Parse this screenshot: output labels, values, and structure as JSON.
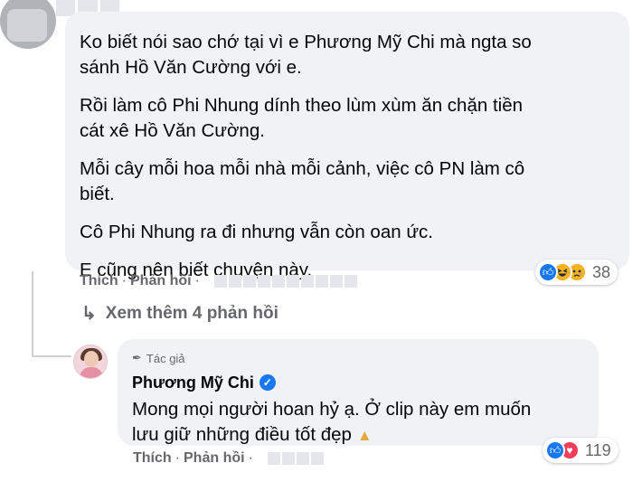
{
  "top_comment": {
    "paragraphs": [
      "Ko biết nói sao chớ tại vì e Phương Mỹ Chi mà ngta so",
      "sánh Hồ Văn Cường với e.",
      "Rồi làm cô Phi Nhung dính theo lùm xùm ăn chặn tiền",
      "cát xê Hồ Văn Cường.",
      "Mỗi cây mỗi hoa mỗi nhà mỗi cảnh, việc cô PN làm cô",
      "biết.",
      "Cô Phi Nhung ra đi nhưng vẫn còn oan ức.",
      "E cũng nên biết chuyện này."
    ],
    "like_label": "Thích",
    "reply_label": "Phản hồi",
    "reaction_count": "38",
    "reactions": [
      "like-icon",
      "haha-icon",
      "sad-icon"
    ]
  },
  "more_replies_label": "Xem thêm 4 phản hồi",
  "reply": {
    "author_badge": "Tác giả",
    "author_name": "Phương Mỹ Chi",
    "text_line1": "Mong mọi người hoan hỷ ạ. Ở clip này em muốn",
    "text_line2": "lưu giữ những điều tốt đẹp",
    "like_label": "Thích",
    "reply_label": "Phản hồi",
    "reaction_count": "119",
    "reactions": [
      "like-icon",
      "love-icon"
    ]
  },
  "colors": {
    "bubble": "#f0f2f5",
    "meta_text": "#65676b",
    "like_blue": "#1877f2",
    "love_red": "#f33e58",
    "reaction_yellow": "#f7b125"
  }
}
